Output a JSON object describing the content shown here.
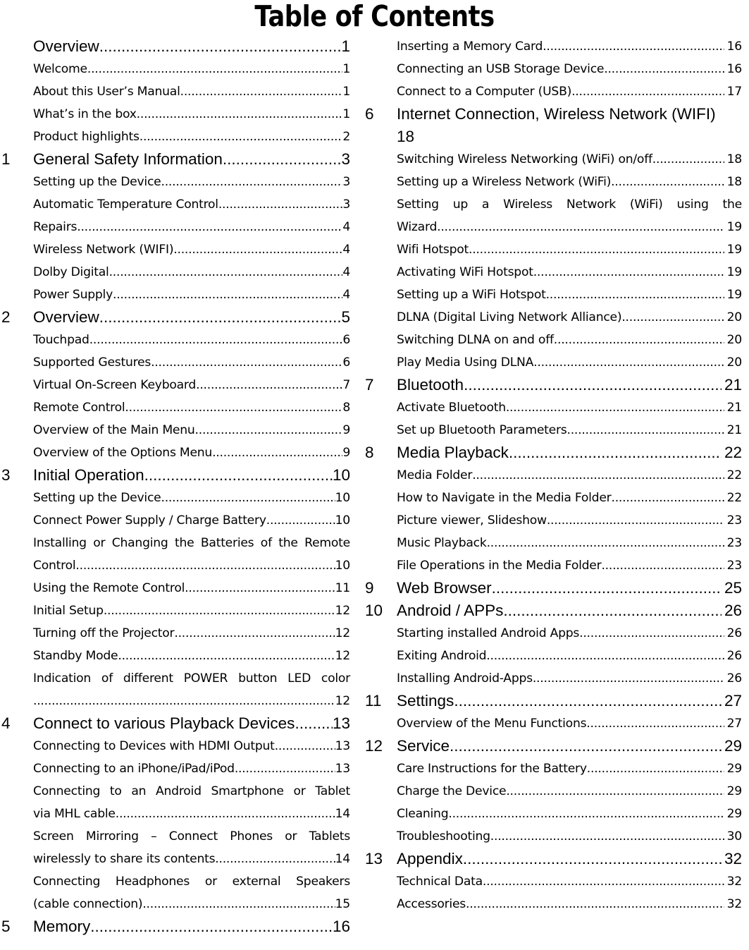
{
  "title": "Table of Contents",
  "leader": "....................................................................................................",
  "columns": {
    "left": [
      {
        "num": "",
        "level": 1,
        "label": "Overview",
        "page": "1"
      },
      {
        "num": "",
        "level": 2,
        "label": "Welcome",
        "page": "1"
      },
      {
        "num": "",
        "level": 2,
        "label": "About this User’s Manual",
        "page": "1"
      },
      {
        "num": "",
        "level": 2,
        "label": "What’s in the box",
        "page": "1"
      },
      {
        "num": "",
        "level": 2,
        "label": "Product highlights",
        "page": "2"
      },
      {
        "num": "1",
        "level": 1,
        "label": "General Safety Information",
        "page": "3"
      },
      {
        "num": "",
        "level": 2,
        "label": "Setting up the Device",
        "page": "3"
      },
      {
        "num": "",
        "level": 2,
        "label": "Automatic Temperature Control",
        "page": "3"
      },
      {
        "num": "",
        "level": 2,
        "label": "Repairs",
        "page": "4"
      },
      {
        "num": "",
        "level": 2,
        "label": "Wireless Network (WIFI)",
        "page": "4"
      },
      {
        "num": "",
        "level": 2,
        "label": "Dolby Digital",
        "page": "4"
      },
      {
        "num": "",
        "level": 2,
        "label": "Power Supply",
        "page": "4"
      },
      {
        "num": "2",
        "level": 1,
        "label": "Overview",
        "page": "5"
      },
      {
        "num": "",
        "level": 2,
        "label": "Touchpad",
        "page": "6"
      },
      {
        "num": "",
        "level": 2,
        "label": "Supported Gestures",
        "page": "6"
      },
      {
        "num": "",
        "level": 2,
        "label": "Virtual On-Screen Keyboard",
        "page": "7"
      },
      {
        "num": "",
        "level": 2,
        "label": "Remote Control",
        "page": "8"
      },
      {
        "num": "",
        "level": 2,
        "label": "Overview of the Main Menu",
        "page": "9"
      },
      {
        "num": "",
        "level": 2,
        "label": "Overview of the Options Menu",
        "page": "9"
      },
      {
        "num": "3",
        "level": 1,
        "label": "Initial Operation",
        "page": "10"
      },
      {
        "num": "",
        "level": 2,
        "label": "Setting up the Device",
        "page": "10"
      },
      {
        "num": "",
        "level": 2,
        "label": "Connect Power Supply / Charge Battery",
        "page": "10"
      },
      {
        "num": "",
        "level": 2,
        "wrapped": true,
        "head": "Installing or Changing the Batteries of the Remote",
        "tail": "Control",
        "page": "10"
      },
      {
        "num": "",
        "level": 2,
        "label": "Using the Remote Control",
        "page": "11"
      },
      {
        "num": "",
        "level": 2,
        "label": "Initial Setup",
        "page": "12"
      },
      {
        "num": "",
        "level": 2,
        "label": "Turning off the Projector",
        "page": "12"
      },
      {
        "num": "",
        "level": 2,
        "label": "Standby Mode",
        "page": "12"
      },
      {
        "num": "",
        "level": 2,
        "wrapped": true,
        "head": "Indication of different POWER button LED color",
        "tail": "",
        "page": "12"
      },
      {
        "num": "4",
        "level": 1,
        "label": "Connect to various Playback Devices",
        "page": "13"
      },
      {
        "num": "",
        "level": 2,
        "label": "Connecting to Devices with HDMI Output",
        "page": "13"
      },
      {
        "num": "",
        "level": 2,
        "label": "Connecting to an iPhone/iPad/iPod",
        "page": "13"
      },
      {
        "num": "",
        "level": 2,
        "wrapped": true,
        "head": "Connecting to an Android Smartphone or Tablet",
        "tail": "via MHL cable",
        "page": "14"
      },
      {
        "num": "",
        "level": 2,
        "wrapped": true,
        "head": "Screen Mirroring – Connect Phones or Tablets",
        "tail": "wirelessly to share its contents",
        "page": "14"
      },
      {
        "num": "",
        "level": 2,
        "wrapped": true,
        "head": "Connecting Headphones or external Speakers",
        "tail": "(cable connection)",
        "page": "15"
      },
      {
        "num": "5",
        "level": 1,
        "label": "Memory",
        "page": "16"
      }
    ],
    "right": [
      {
        "num": "",
        "level": 2,
        "label": "Inserting a Memory Card",
        "page": "16"
      },
      {
        "num": "",
        "level": 2,
        "label": "Connecting an USB Storage Device",
        "page": "16"
      },
      {
        "num": "",
        "level": 2,
        "label": "Connect to a Computer (USB)",
        "page": "17"
      },
      {
        "num": "6",
        "level": 1,
        "orphan": true,
        "head": "Internet Connection, Wireless Network (WIFI)",
        "page": "18"
      },
      {
        "num": "",
        "level": 2,
        "label": "Switching Wireless Networking (WiFi) on/off",
        "page": "18"
      },
      {
        "num": "",
        "level": 2,
        "label": "Setting up a Wireless Network (WiFi)",
        "page": "18"
      },
      {
        "num": "",
        "level": 2,
        "wrapped": true,
        "head": "Setting up a Wireless Network (WiFi) using the",
        "tail": "Wizard",
        "page": "19"
      },
      {
        "num": "",
        "level": 2,
        "label": "Wifi Hotspot",
        "page": "19"
      },
      {
        "num": "",
        "level": 2,
        "label": "Activating WiFi Hotspot",
        "page": "19"
      },
      {
        "num": "",
        "level": 2,
        "label": "Setting up a WiFi Hotspot",
        "page": "19"
      },
      {
        "num": "",
        "level": 2,
        "label": "DLNA (Digital Living Network Alliance)",
        "page": "20"
      },
      {
        "num": "",
        "level": 2,
        "label": "Switching DLNA on and off",
        "page": "20"
      },
      {
        "num": "",
        "level": 2,
        "label": "Play Media Using DLNA",
        "page": "20"
      },
      {
        "num": "7",
        "level": 1,
        "label": "Bluetooth",
        "page": "21"
      },
      {
        "num": "",
        "level": 2,
        "label": "Activate Bluetooth",
        "page": "21"
      },
      {
        "num": "",
        "level": 2,
        "label": "Set up Bluetooth Parameters",
        "page": "21"
      },
      {
        "num": "8",
        "level": 1,
        "label": "Media Playback",
        "page": "22"
      },
      {
        "num": "",
        "level": 2,
        "label": "Media Folder",
        "page": "22"
      },
      {
        "num": "",
        "level": 2,
        "label": "How to Navigate in the Media Folder",
        "page": "22"
      },
      {
        "num": "",
        "level": 2,
        "label": "Picture viewer, Slideshow",
        "page": "23"
      },
      {
        "num": "",
        "level": 2,
        "label": "Music Playback",
        "page": "23"
      },
      {
        "num": "",
        "level": 2,
        "label": "File Operations in the Media Folder",
        "page": "23"
      },
      {
        "num": "9",
        "level": 1,
        "label": "Web Browser",
        "page": "25"
      },
      {
        "num": "10",
        "level": 1,
        "label": "Android / APPs",
        "page": "26"
      },
      {
        "num": "",
        "level": 2,
        "label": "Starting installed Android Apps",
        "page": "26"
      },
      {
        "num": "",
        "level": 2,
        "label": "Exiting Android",
        "page": "26"
      },
      {
        "num": "",
        "level": 2,
        "label": "Installing Android-Apps",
        "page": "26"
      },
      {
        "num": "11",
        "level": 1,
        "label": "Settings",
        "page": "27"
      },
      {
        "num": "",
        "level": 2,
        "label": "Overview of the Menu Functions",
        "page": "27"
      },
      {
        "num": "12",
        "level": 1,
        "label": "Service",
        "page": "29"
      },
      {
        "num": "",
        "level": 2,
        "label": "Care Instructions for the Battery",
        "page": "29"
      },
      {
        "num": "",
        "level": 2,
        "label": "Charge the Device",
        "page": "29"
      },
      {
        "num": "",
        "level": 2,
        "label": "Cleaning",
        "page": "29"
      },
      {
        "num": "",
        "level": 2,
        "label": "Troubleshooting",
        "page": "30"
      },
      {
        "num": "13",
        "level": 1,
        "label": "Appendix",
        "page": "32"
      },
      {
        "num": "",
        "level": 2,
        "label": "Technical Data",
        "page": "32"
      },
      {
        "num": "",
        "level": 2,
        "label": "Accessories",
        "page": "32"
      }
    ]
  }
}
